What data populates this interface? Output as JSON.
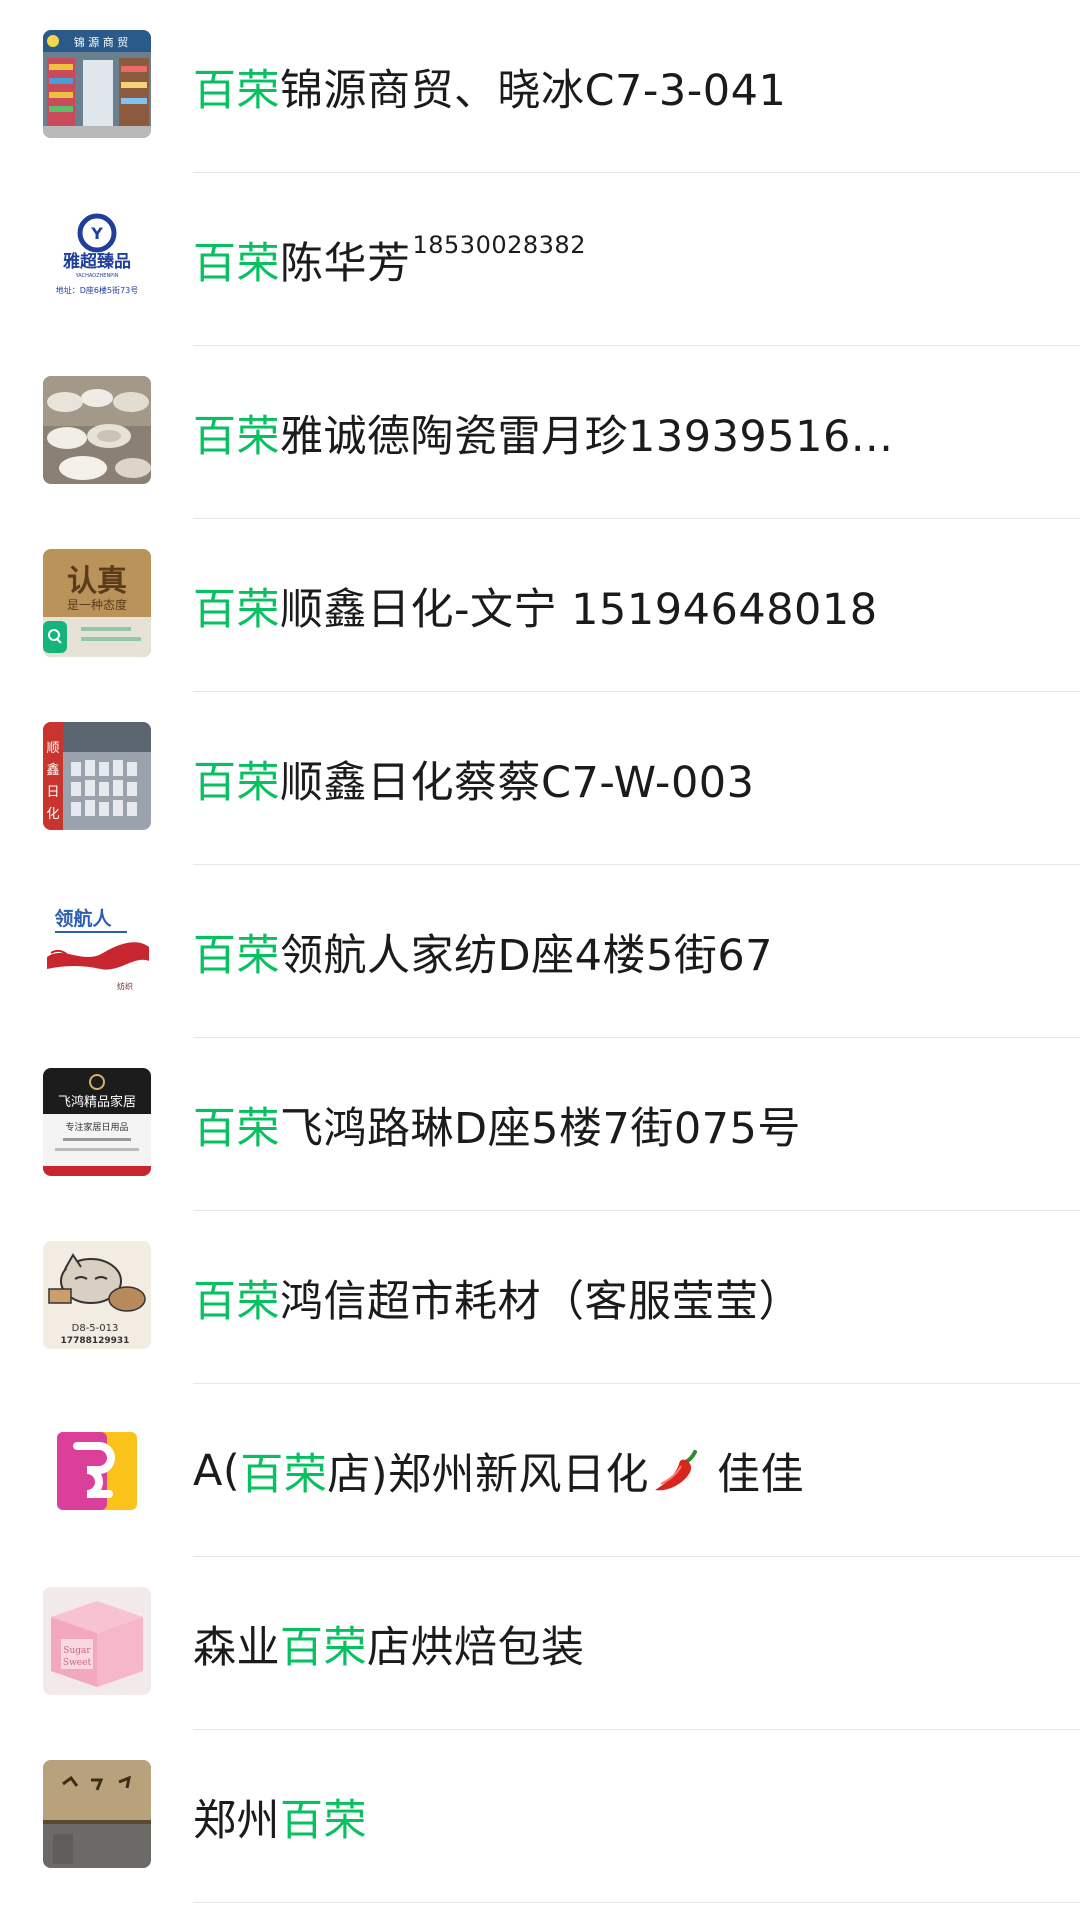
{
  "highlight_color": "#07c160",
  "contacts": [
    {
      "prefix": "",
      "hl": "百荣",
      "suffix": "锦源商贸、晓冰C7-3-041",
      "avatar": "store-shelves-photo"
    },
    {
      "prefix": "",
      "hl": "百荣",
      "suffix": "陈华芳",
      "sup": "18530028382",
      "avatar": "yachao-logo",
      "avatar_text": {
        "name": "雅超臻品",
        "pinyin": "YACHAOZHENPIN",
        "addr": "地址：D座6楼5街73号"
      }
    },
    {
      "prefix": "",
      "hl": "百荣",
      "suffix": "雅诚德陶瓷雷月珍13939516...",
      "avatar": "ceramic-bowls-photo"
    },
    {
      "prefix": "",
      "hl": "百荣",
      "suffix": "顺鑫日化-文宁 15194648018",
      "avatar": "renzhen-wood-sign",
      "avatar_text": {
        "big": "认真",
        "small": "是一种态度"
      }
    },
    {
      "prefix": "",
      "hl": "百荣",
      "suffix": "顺鑫日化蔡蔡C7-W-003",
      "avatar": "shunxin-warehouse-photo",
      "avatar_text": {
        "side": "顺鑫日化"
      }
    },
    {
      "prefix": "",
      "hl": "百荣",
      "suffix": "领航人家纺D座4楼5街67",
      "avatar": "linghangren-ribbon-logo",
      "avatar_text": {
        "name": "领航人"
      }
    },
    {
      "prefix": "",
      "hl": "百荣",
      "suffix": "飞鸿路琳D座5楼7街075号",
      "avatar": "feihong-card",
      "avatar_text": {
        "name": "飞鸿精品家居",
        "slogan": "专注家居日用品"
      }
    },
    {
      "prefix": "",
      "hl": "百荣",
      "suffix": "鸿信超市耗材（客服莹莹）",
      "avatar": "cartoon-sleeping-cat",
      "avatar_text": {
        "code": "D8-5-013",
        "phone": "17788129931"
      }
    },
    {
      "prefix": "A(",
      "hl": "百荣",
      "suffix": "店)郑州新风日化",
      "emoji": "pepper",
      "tail": "佳佳",
      "avatar": "pink-yellow-logo"
    },
    {
      "prefix": "森业",
      "hl": "百荣",
      "suffix": "店烘焙包装",
      "avatar": "pink-cake-box-photo"
    },
    {
      "prefix": "郑州",
      "hl": "百荣",
      "suffix": "",
      "avatar": "stone-wall-photo"
    }
  ]
}
